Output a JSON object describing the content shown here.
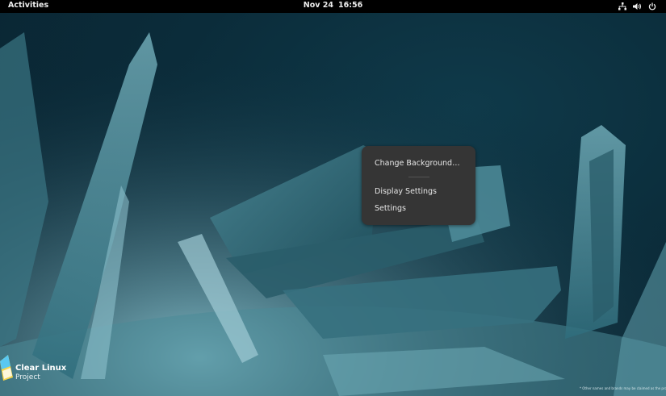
{
  "topbar": {
    "activities": "Activities",
    "date": "Nov 24",
    "time": "16:56",
    "icons": [
      "network-icon",
      "volume-icon",
      "power-icon"
    ]
  },
  "context_menu": {
    "items": [
      {
        "label": "Change Background…"
      },
      {
        "label": "Display Settings"
      },
      {
        "label": "Settings"
      }
    ]
  },
  "wallpaper": {
    "logo_line1": "Clear Linux",
    "logo_line2": "Project",
    "disclaimer": "* Other names and brands may be claimed as the property of others"
  }
}
